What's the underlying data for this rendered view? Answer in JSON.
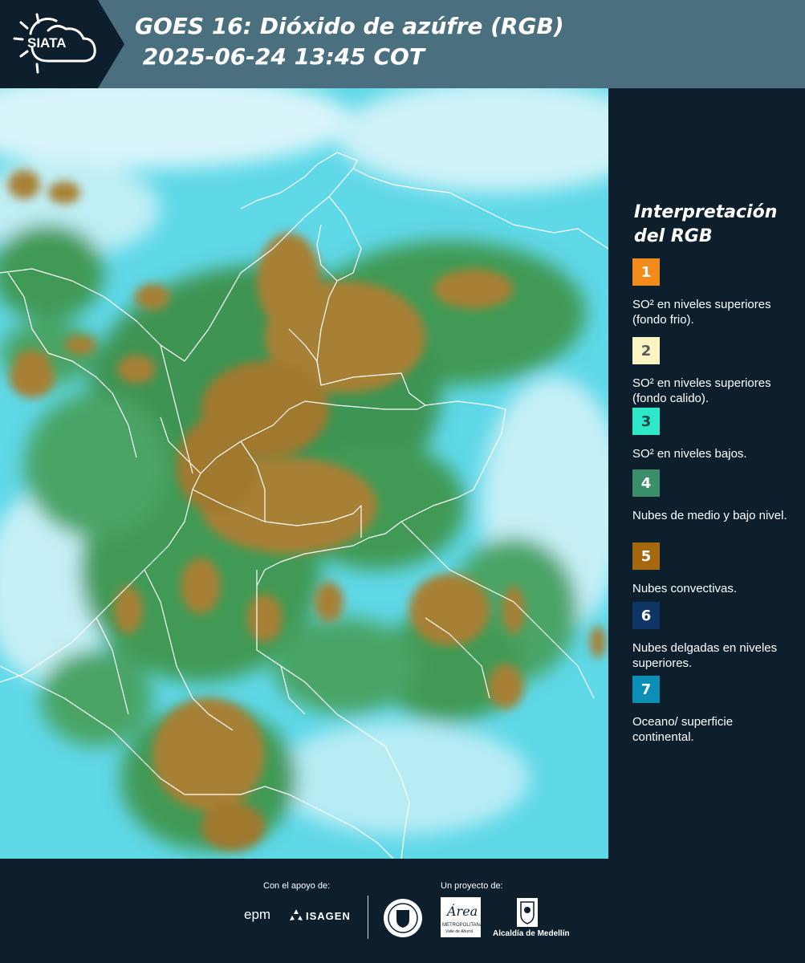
{
  "header": {
    "logo_text": "SIATA",
    "title_line1": "GOES 16: Dióxido de azúfre (RGB)",
    "title_line2": " 2025-06-24 13:45 COT"
  },
  "legend": {
    "title": "Interpretación del RGB",
    "items": [
      {
        "number": "1",
        "color": "#f28a1c",
        "text_color": "#ffffff",
        "label": "SO² en niveles superiores (fondo frio)."
      },
      {
        "number": "2",
        "color": "#fbf5c4",
        "text_color": "#5a5a5a",
        "label": "SO² en niveles superiores (fondo calido)."
      },
      {
        "number": "3",
        "color": "#2ee8c9",
        "text_color": "#1a4a48",
        "label": "SO² en niveles bajos."
      },
      {
        "number": "4",
        "color": "#3a8f6a",
        "text_color": "#ffffff",
        "label": "Nubes de medio y bajo nivel."
      },
      {
        "number": "5",
        "color": "#a5680f",
        "text_color": "#ffffff",
        "label": "Nubes convectivas."
      },
      {
        "number": "6",
        "color": "#0f3566",
        "text_color": "#ffffff",
        "label": "Nubes delgadas en niveles superiores."
      },
      {
        "number": "7",
        "color": "#0b8fb5",
        "text_color": "#ffffff",
        "label": "Oceano/ superficie continental."
      }
    ]
  },
  "footer": {
    "support_label": "Con el apoyo de:",
    "project_label": "Un proyecto de:",
    "sponsor_epm": "epm",
    "sponsor_isagen": "ISAGEN",
    "partner_area": "Área",
    "partner_area_sub": "METROPOLITANA",
    "partner_area_sub2": "Valle de Aburrá",
    "partner_alcaldia": "Alcaldía de Medellín"
  },
  "colors": {
    "header_bg": "#4a7080",
    "logo_bg": "#0d1f2c",
    "panel_bg": "#0d1f2c",
    "map_sky": "#5fd8e8",
    "map_cloud_white": "#dff7fb",
    "map_green": "#3f9a55",
    "map_brown": "#a78034"
  }
}
